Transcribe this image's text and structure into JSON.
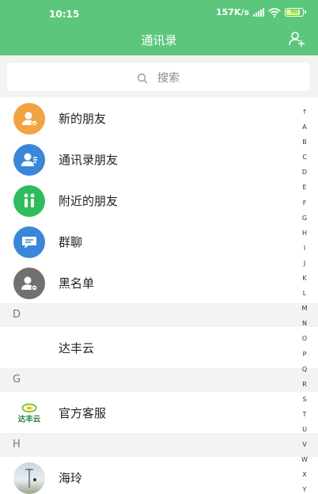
{
  "status": {
    "time": "10:15",
    "speed": "157K/s",
    "battery": "90"
  },
  "header": {
    "title": "通讯录"
  },
  "search": {
    "placeholder": "搜索"
  },
  "menu": [
    {
      "label": "新的朋友",
      "icon": "new-friend-icon",
      "color": "#f2a444"
    },
    {
      "label": "通讯录朋友",
      "icon": "contacts-friend-icon",
      "color": "#3a86d8"
    },
    {
      "label": "附近的朋友",
      "icon": "nearby-friend-icon",
      "color": "#2fbc5c"
    },
    {
      "label": "群聊",
      "icon": "group-chat-icon",
      "color": "#3a86d8"
    },
    {
      "label": "黑名单",
      "icon": "blacklist-icon",
      "color": "#707070"
    }
  ],
  "sections": [
    {
      "letter": "D",
      "contacts": [
        {
          "name": "达丰云"
        }
      ]
    },
    {
      "letter": "G",
      "contacts": [
        {
          "name": "官方客服",
          "logo_text": "达丰云"
        }
      ]
    },
    {
      "letter": "H",
      "contacts": [
        {
          "name": "海玲"
        }
      ]
    }
  ],
  "index": [
    "↑",
    "A",
    "B",
    "C",
    "D",
    "E",
    "F",
    "G",
    "H",
    "I",
    "J",
    "K",
    "L",
    "M",
    "N",
    "O",
    "P",
    "Q",
    "R",
    "S",
    "T",
    "U",
    "V",
    "W",
    "X",
    "Y"
  ]
}
